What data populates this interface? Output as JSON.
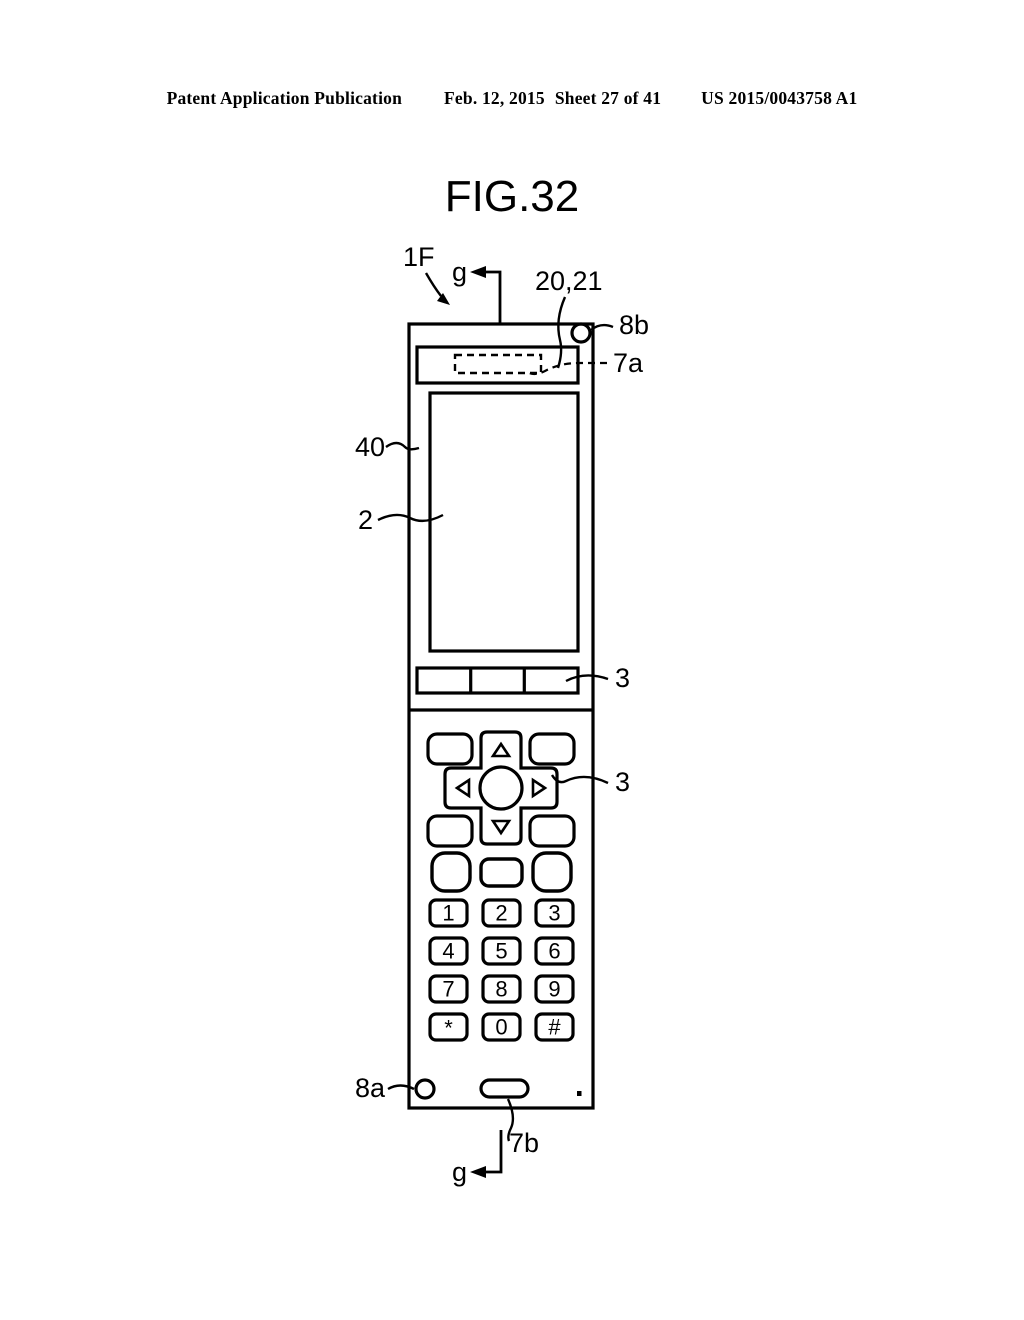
{
  "header": {
    "publication": "Patent Application Publication",
    "date": "Feb. 12, 2015",
    "sheet": "Sheet 27 of 41",
    "patent_number": "US 2015/0043758 A1"
  },
  "figure": {
    "title": "FIG.32",
    "description": "Front view of a mobile phone handset showing display, soft keys, directional pad and numeric keypad with reference numerals."
  },
  "reference_labels": {
    "device": "1F",
    "section_top": "g",
    "section_bottom": "g",
    "speaker_unit": "20,21",
    "camera_top": "8b",
    "vibration_top": "7a",
    "housing": "40",
    "display": "2",
    "keys_upper": "3",
    "keys_dpad": "3",
    "camera_bottom": "8a",
    "microphone": "7b"
  },
  "keypad": {
    "rows": [
      [
        "1",
        "2",
        "3"
      ],
      [
        "4",
        "5",
        "6"
      ],
      [
        "7",
        "8",
        "9"
      ],
      [
        "*",
        "0",
        "#"
      ]
    ]
  },
  "dpad": {
    "up": "▲",
    "down": "▼",
    "left": "◀",
    "right": "▶"
  },
  "colors": {
    "ink": "#000000",
    "paper": "#ffffff"
  }
}
